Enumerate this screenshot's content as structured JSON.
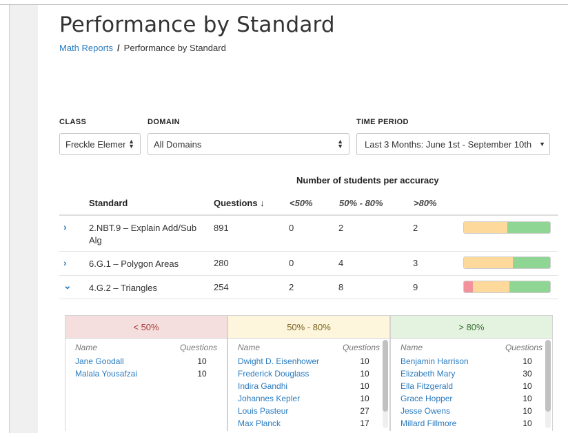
{
  "page": {
    "title": "Performance by Standard",
    "breadcrumb": {
      "parent": "Math Reports",
      "separator": "/",
      "current": "Performance by Standard"
    }
  },
  "filters": {
    "class": {
      "label": "CLASS",
      "value": "Freckle Element"
    },
    "domain": {
      "label": "DOMAIN",
      "value": "All Domains"
    },
    "time_period": {
      "label": "TIME PERIOD",
      "value": "Last 3 Months: June 1st - September 10th"
    }
  },
  "table": {
    "group_header": "Number of students per accuracy",
    "headers": {
      "standard": "Standard",
      "questions": "Questions ↓",
      "low": "<50%",
      "mid": "50% - 80%",
      "high": ">80%"
    },
    "rows": [
      {
        "expanded": false,
        "chevron": "›",
        "standard": "2.NBT.9 – Explain Add/Sub Alg",
        "questions": "891",
        "low": "0",
        "mid": "2",
        "high": "2"
      },
      {
        "expanded": false,
        "chevron": "›",
        "standard": "6.G.1 – Polygon Areas",
        "questions": "280",
        "low": "0",
        "mid": "4",
        "high": "3"
      },
      {
        "expanded": true,
        "chevron": "⌄",
        "standard": "4.G.2 – Triangles",
        "questions": "254",
        "low": "2",
        "mid": "8",
        "high": "9"
      }
    ]
  },
  "detail_panels": {
    "column_name": "Name",
    "column_questions": "Questions",
    "low": {
      "title": "< 50%",
      "students": [
        {
          "name": "Jane Goodall",
          "questions": "10"
        },
        {
          "name": "Malala Yousafzai",
          "questions": "10"
        }
      ]
    },
    "mid": {
      "title": "50% - 80%",
      "students": [
        {
          "name": "Dwight D. Eisenhower",
          "questions": "10"
        },
        {
          "name": "Frederick Douglass",
          "questions": "10"
        },
        {
          "name": "Indira Gandhi",
          "questions": "10"
        },
        {
          "name": "Johannes Kepler",
          "questions": "10"
        },
        {
          "name": "Louis Pasteur",
          "questions": "27"
        },
        {
          "name": "Max Planck",
          "questions": "17"
        }
      ]
    },
    "high": {
      "title": "> 80%",
      "students": [
        {
          "name": "Benjamin Harrison",
          "questions": "10"
        },
        {
          "name": "Elizabeth Mary",
          "questions": "30"
        },
        {
          "name": "Ella Fitzgerald",
          "questions": "10"
        },
        {
          "name": "Grace Hopper",
          "questions": "10"
        },
        {
          "name": "Jesse Owens",
          "questions": "10"
        },
        {
          "name": "Millard Fillmore",
          "questions": "10"
        }
      ]
    }
  },
  "colors": {
    "link": "#2a7bbf",
    "low": "#f2939b",
    "mid": "#fdd99b",
    "high": "#8fd594"
  },
  "icons": {
    "select_arrows": "updown-arrows-icon",
    "dropdown_caret": "caret-down-icon",
    "row_collapsed": "chevron-right-icon",
    "row_expanded": "chevron-down-icon"
  }
}
